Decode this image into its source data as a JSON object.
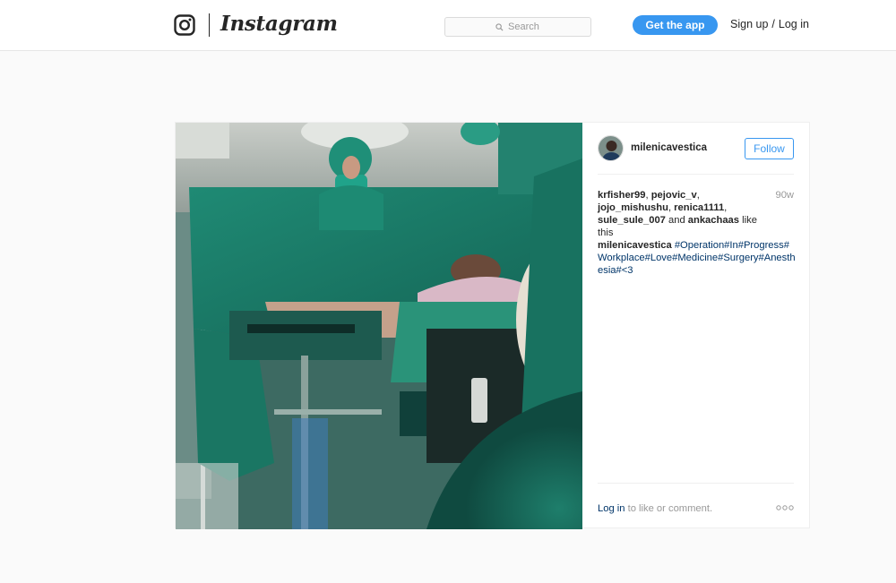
{
  "header": {
    "wordmark": "Instagram",
    "search_placeholder": "Search",
    "get_app_label": "Get the app",
    "signup_label": "Sign up",
    "separator": "/",
    "login_label": "Log in",
    "accent_color": "#3897f0"
  },
  "post": {
    "username": "milenicavestica",
    "follow_label": "Follow",
    "likers": [
      "krfisher99",
      "pejovic_v",
      "jojo_mishushu",
      "renica1111",
      "sule_sule_007",
      "ankachaas"
    ],
    "likes_and_label": "and",
    "likes_suffix": "like this",
    "age": "90w",
    "caption_user": "milenicavestica",
    "caption_text": "#Operation#In#Progress#Workplace#Love#Medicine#Surgery#Anesthesia#<3",
    "footer_login": "Log in",
    "footer_suffix": "to like or comment.",
    "icons": {
      "logo": "instagram-camera-icon",
      "search": "search-icon",
      "more": "more-options-icon"
    }
  }
}
